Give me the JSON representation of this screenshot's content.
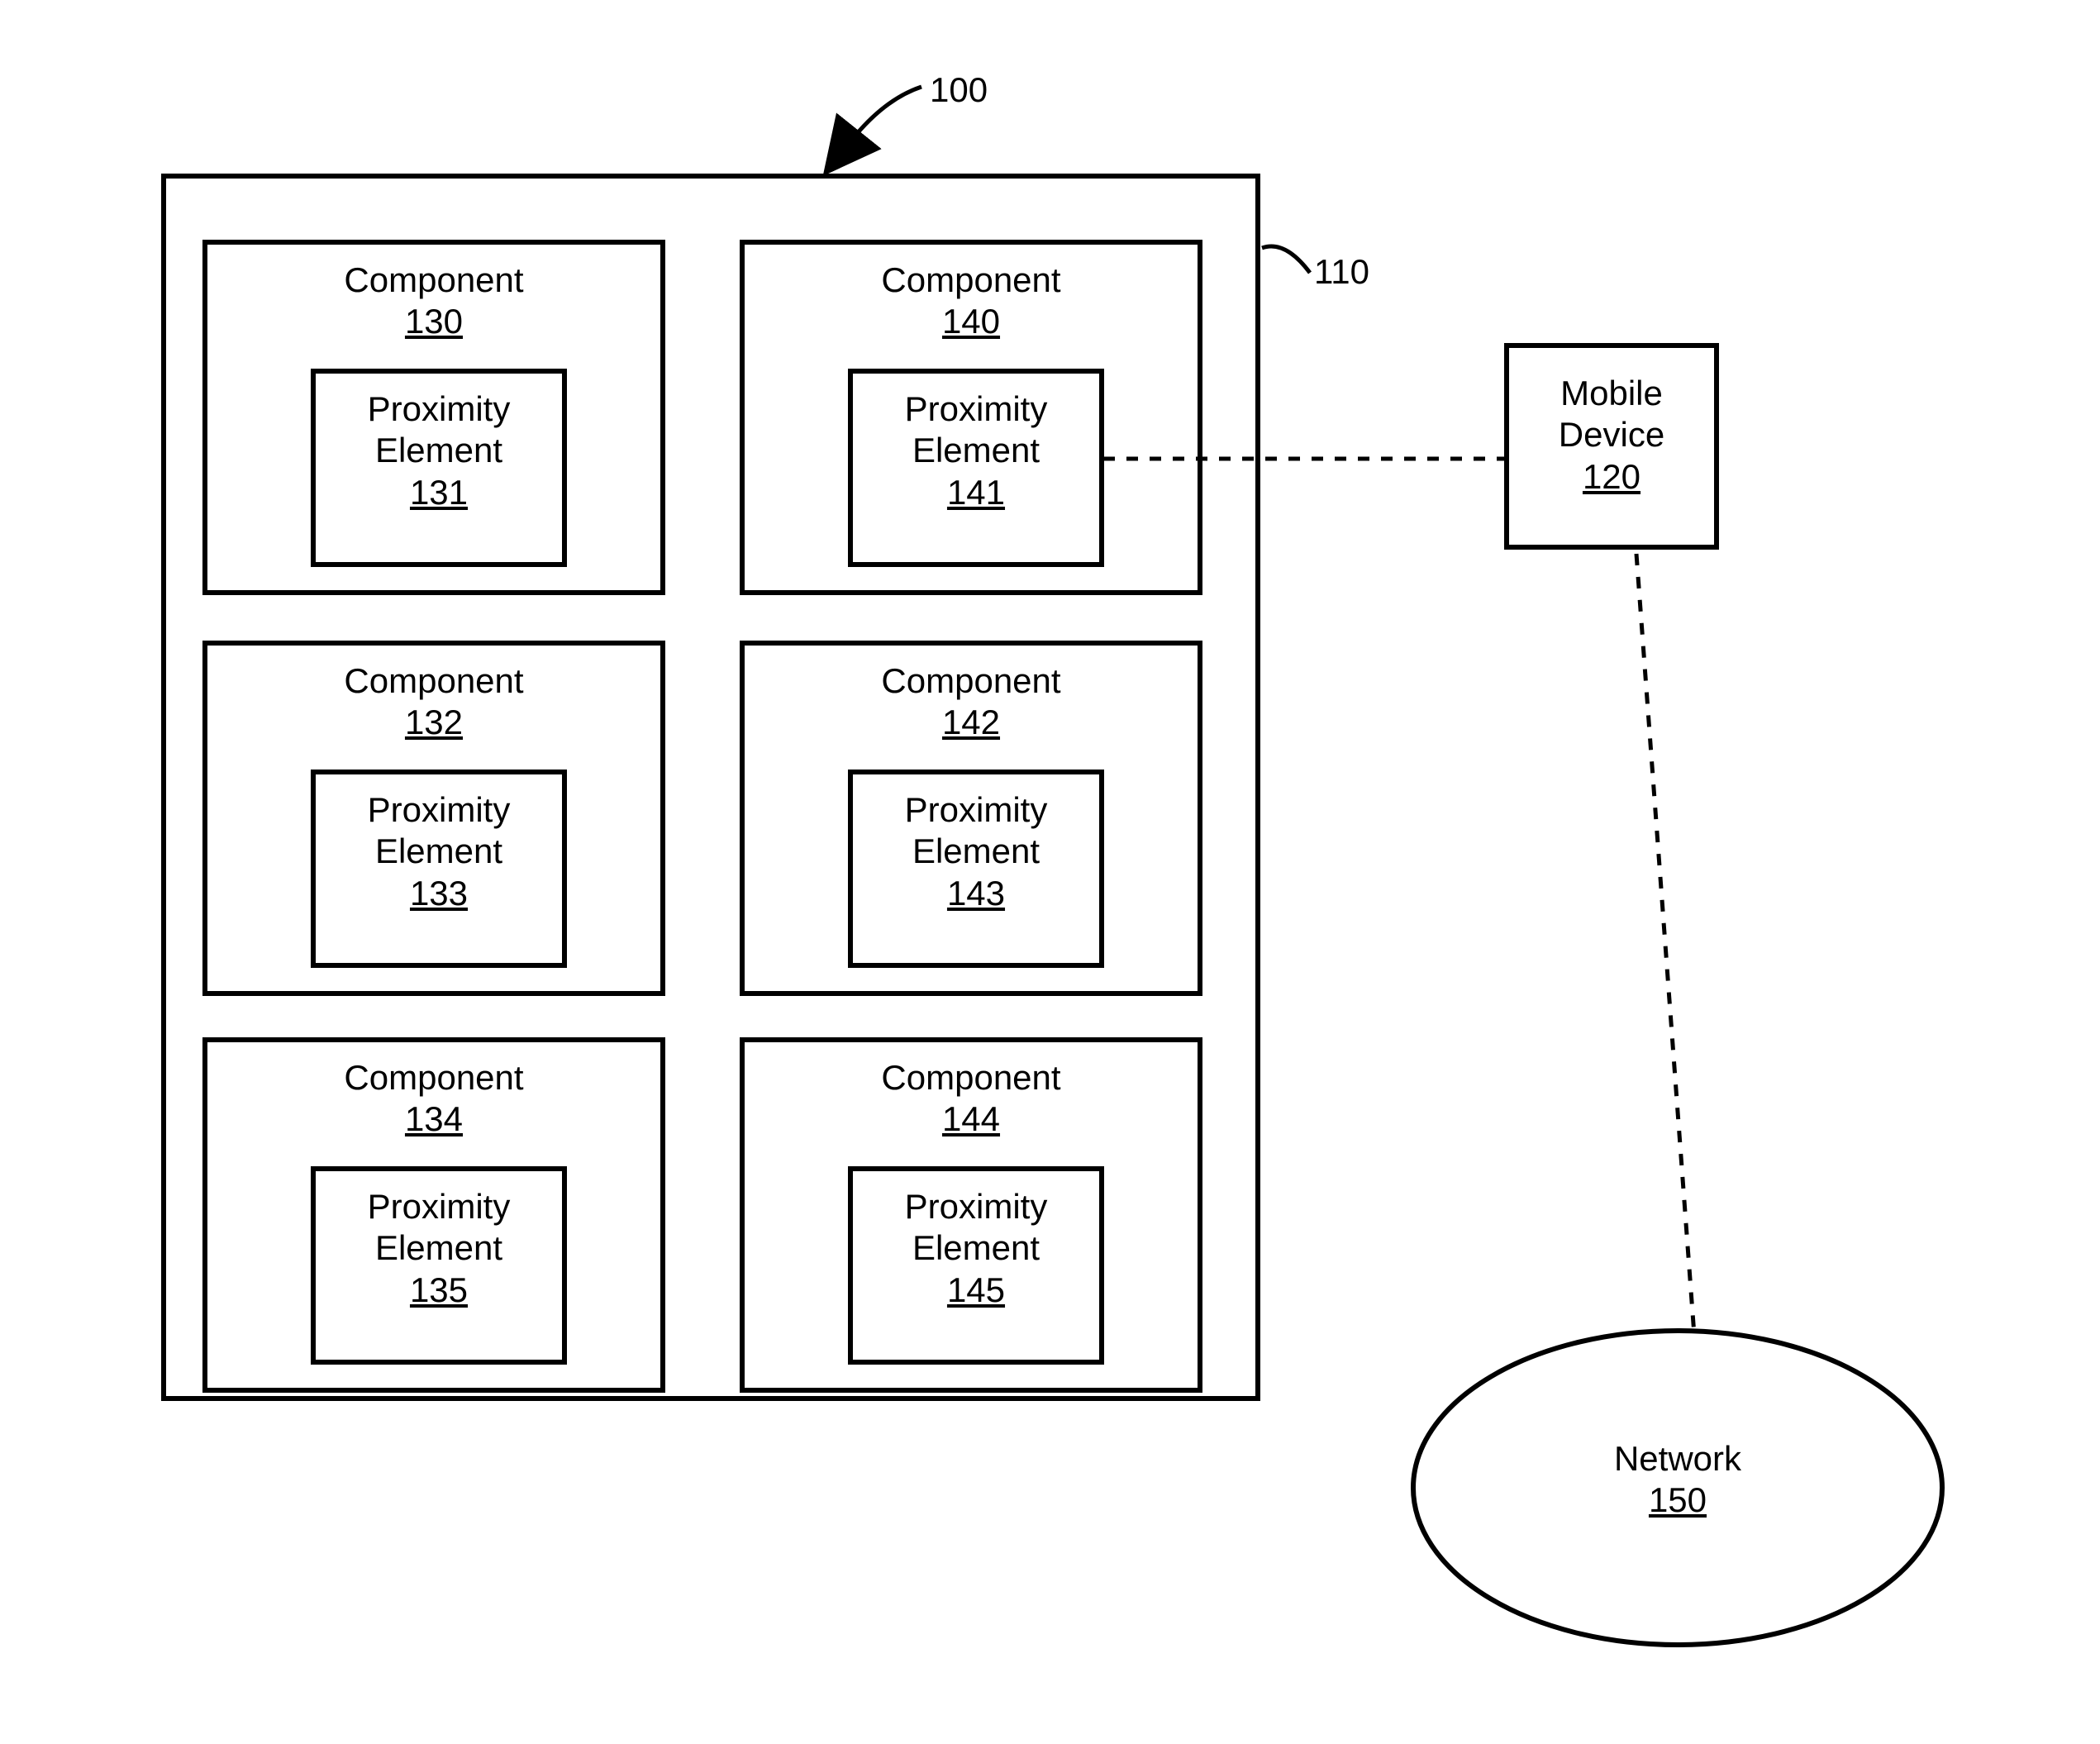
{
  "figure_ref": "100",
  "container_ref": "110",
  "mobile": {
    "label": "Mobile\nDevice",
    "ref": "120"
  },
  "network": {
    "label": "Network",
    "ref": "150"
  },
  "components": [
    {
      "title": "Component",
      "ref": "130",
      "prox_title": "Proximity\nElement",
      "prox_ref": "131"
    },
    {
      "title": "Component",
      "ref": "140",
      "prox_title": "Proximity\nElement",
      "prox_ref": "141"
    },
    {
      "title": "Component",
      "ref": "132",
      "prox_title": "Proximity\nElement",
      "prox_ref": "133"
    },
    {
      "title": "Component",
      "ref": "142",
      "prox_title": "Proximity\nElement",
      "prox_ref": "143"
    },
    {
      "title": "Component",
      "ref": "134",
      "prox_title": "Proximity\nElement",
      "prox_ref": "135"
    },
    {
      "title": "Component",
      "ref": "144",
      "prox_title": "Proximity\nElement",
      "prox_ref": "145"
    }
  ]
}
